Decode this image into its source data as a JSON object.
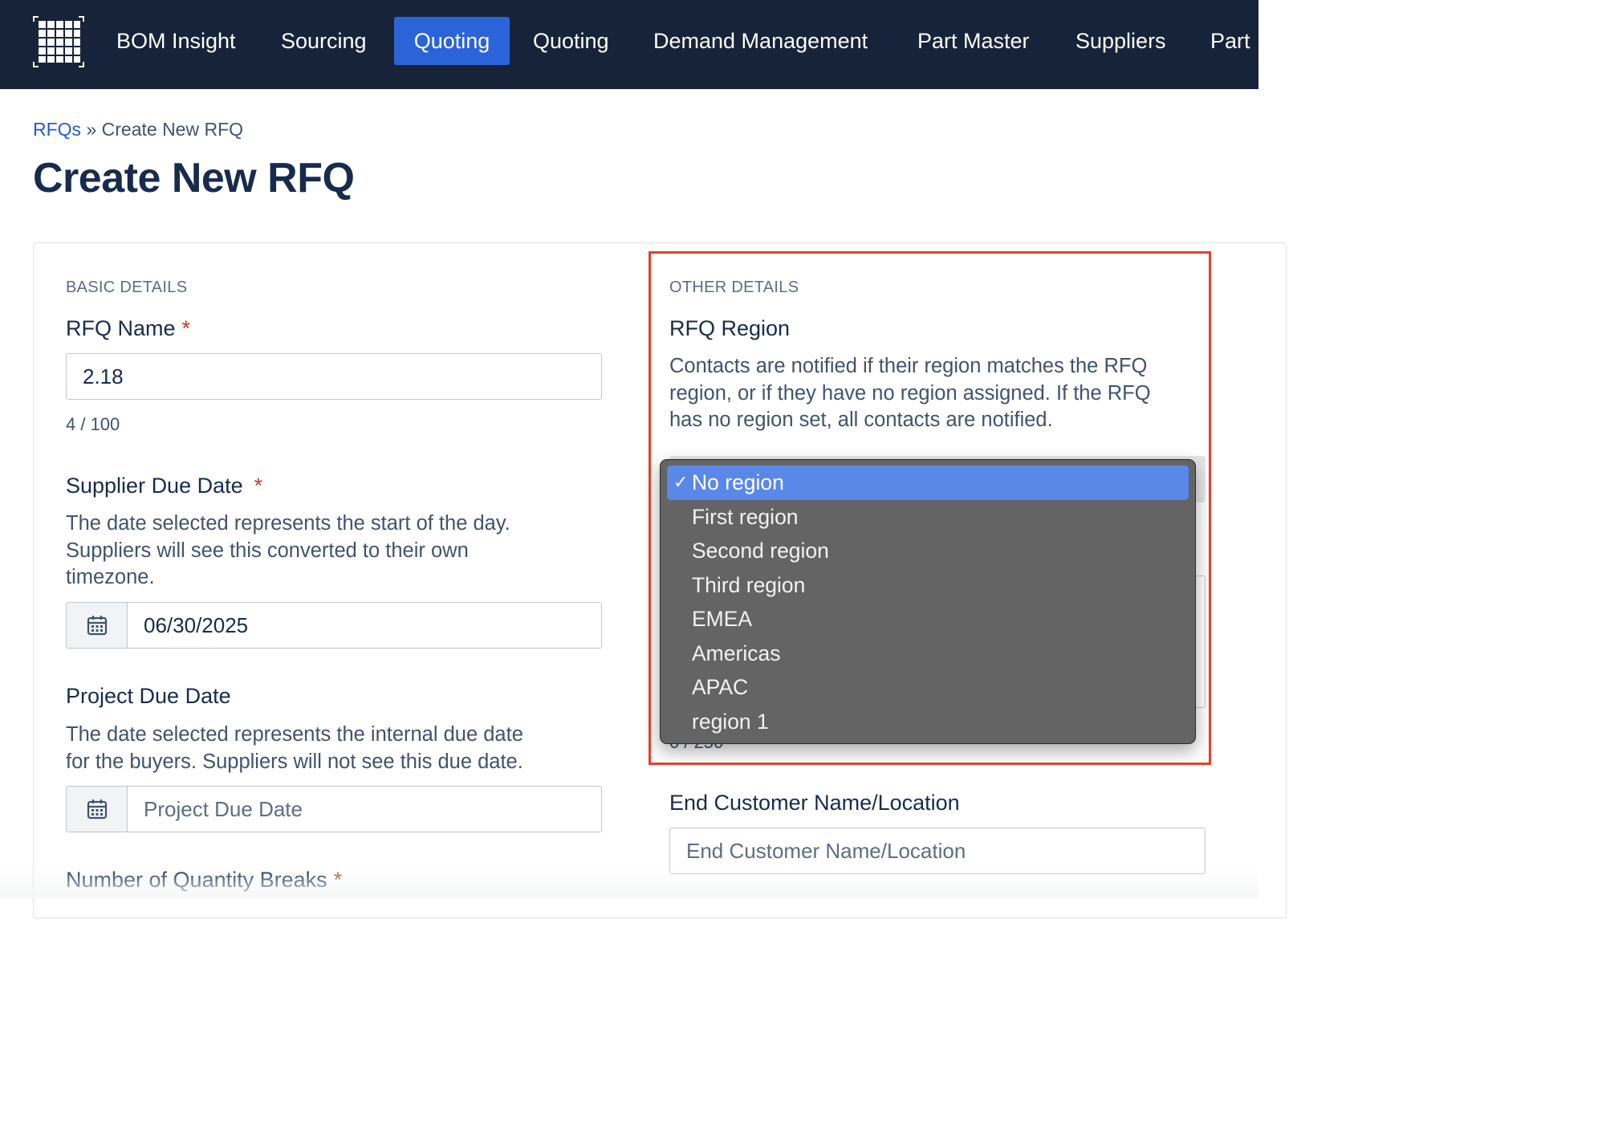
{
  "nav": {
    "items": [
      {
        "label": "BOM Insight",
        "active": false
      },
      {
        "label": "Sourcing",
        "active": false
      },
      {
        "label": "Quoting",
        "active": true
      },
      {
        "label": "Quoting",
        "active": false
      },
      {
        "label": "Demand Management",
        "active": false
      },
      {
        "label": "Part Master",
        "active": false
      },
      {
        "label": "Suppliers",
        "active": false
      },
      {
        "label": "Part",
        "active": false
      }
    ]
  },
  "breadcrumb": {
    "link": "RFQs",
    "separator": "»",
    "current": "Create New RFQ"
  },
  "page": {
    "title": "Create New RFQ"
  },
  "basic_details": {
    "heading": "BASIC DETAILS",
    "rfq_name": {
      "label": "RFQ Name",
      "required": "*",
      "value": "2.18",
      "counter": "4 / 100"
    },
    "supplier_due_date": {
      "label": "Supplier Due Date",
      "required": "*",
      "help_line1": "The date selected represents the start of the day.",
      "help_line2": "Suppliers will see this converted to their own",
      "help_line3": "timezone.",
      "value": "06/30/2025"
    },
    "project_due_date": {
      "label": "Project Due Date",
      "help_line1": "The date selected represents the internal due date",
      "help_line2": "for the buyers. Suppliers will not see this due date.",
      "placeholder": "Project Due Date"
    },
    "quantity_breaks": {
      "label": "Number of Quantity Breaks",
      "required": "*"
    }
  },
  "other_details": {
    "heading": "OTHER DETAILS",
    "rfq_region": {
      "label": "RFQ Region",
      "help_line1": "Contacts are notified if their region matches the RFQ",
      "help_line2": "region, or if they have no region assigned. If the RFQ",
      "help_line3": "has no region set, all contacts are notified.",
      "selected": "No region",
      "options": [
        "No region",
        "First region",
        "Second region",
        "Third region",
        "EMEA",
        "Americas",
        "APAC",
        "region 1"
      ]
    },
    "partial_counter": "0 / 250",
    "end_customer": {
      "label": "End Customer Name/Location",
      "placeholder": "End Customer Name/Location"
    }
  },
  "colors": {
    "nav_bg": "#172339",
    "nav_active": "#2b63d9",
    "highlight_border": "#e2412c",
    "dropdown_bg": "#646464",
    "dropdown_selected": "#5a88e8",
    "required": "#c9372c",
    "link": "#1f5bd6"
  },
  "icons": {
    "logo": "grid-logo-icon",
    "calendar": "calendar-icon",
    "check": "checkmark-icon"
  }
}
